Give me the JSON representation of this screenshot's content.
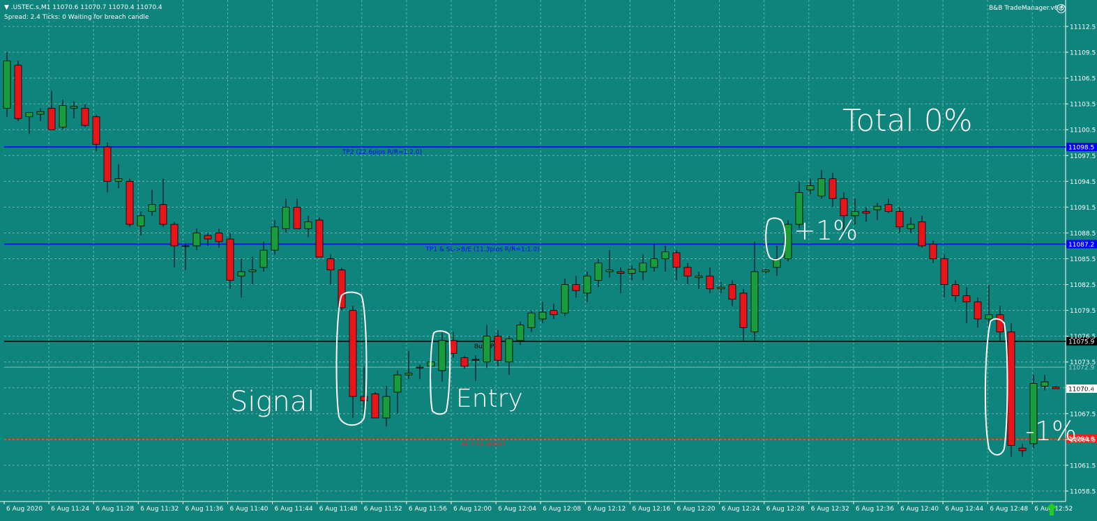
{
  "header": {
    "symbol_line": ".USTEC.s,M1  11070.6 11070.7 11070.4 11070.4",
    "status_line": "Spread: 2.4   Ticks: 0   Waiting for breach candle",
    "brand": "B&B TradeManager.v6.6",
    "colors": {
      "background": "#0e847c",
      "bull": "#1a9c3a",
      "bear": "#e8141c",
      "tp_line": "#0000ff",
      "sl_line": "#ff1a1a",
      "entry_line": "#000000",
      "grid": "#69b3ad"
    }
  },
  "annotations": {
    "total": "Total 0%",
    "plus": "+1%",
    "minus": "-1%",
    "signal": "Signal",
    "entry": "Entry"
  },
  "chart_data": {
    "type": "candlestick",
    "title": "",
    "xlabel": "",
    "ylabel": "",
    "ylim": [
      11057.5,
      11114.0
    ],
    "y_ticks": [
      "11112.5",
      "11109.5",
      "11106.5",
      "11103.5",
      "11100.5",
      "11097.5",
      "11094.5",
      "11091.5",
      "11088.5",
      "11085.5",
      "11082.5",
      "11079.5",
      "11076.5",
      "11073.5",
      "11070.5",
      "11067.5",
      "11064.5",
      "11061.5",
      "11058.5"
    ],
    "x_ticks": [
      "6 Aug 2020",
      "6 Aug 11:24",
      "6 Aug 11:28",
      "6 Aug 11:32",
      "6 Aug 11:36",
      "6 Aug 11:40",
      "6 Aug 11:44",
      "6 Aug 11:48",
      "6 Aug 11:52",
      "6 Aug 11:56",
      "6 Aug 12:00",
      "6 Aug 12:04",
      "6 Aug 12:08",
      "6 Aug 12:12",
      "6 Aug 12:16",
      "6 Aug 12:20",
      "6 Aug 12:24",
      "6 Aug 12:28",
      "6 Aug 12:32",
      "6 Aug 12:36",
      "6 Aug 12:40",
      "6 Aug 12:44",
      "6 Aug 12:48",
      "6 Aug 12:52"
    ],
    "candles": [
      {
        "o": 11103.0,
        "h": 11109.5,
        "l": 11102.0,
        "c": 11108.5
      },
      {
        "o": 11108.0,
        "h": 11108.5,
        "l": 11101.5,
        "c": 11101.8
      },
      {
        "o": 11102.0,
        "h": 11102.5,
        "l": 11100.0,
        "c": 11102.5
      },
      {
        "o": 11102.3,
        "h": 11103.0,
        "l": 11101.5,
        "c": 11102.6
      },
      {
        "o": 11103.0,
        "h": 11105.0,
        "l": 11100.5,
        "c": 11100.5
      },
      {
        "o": 11100.8,
        "h": 11104.0,
        "l": 11100.5,
        "c": 11103.3
      },
      {
        "o": 11103.0,
        "h": 11103.8,
        "l": 11101.8,
        "c": 11103.2
      },
      {
        "o": 11103.0,
        "h": 11103.5,
        "l": 11100.8,
        "c": 11101.0
      },
      {
        "o": 11102.0,
        "h": 11102.2,
        "l": 11098.0,
        "c": 11098.8
      },
      {
        "o": 11098.5,
        "h": 11099.0,
        "l": 11093.2,
        "c": 11094.5
      },
      {
        "o": 11094.5,
        "h": 11096.5,
        "l": 11093.7,
        "c": 11094.8
      },
      {
        "o": 11094.5,
        "h": 11094.8,
        "l": 11089.2,
        "c": 11089.5
      },
      {
        "o": 11089.3,
        "h": 11091.0,
        "l": 11088.2,
        "c": 11090.5
      },
      {
        "o": 11091.0,
        "h": 11093.5,
        "l": 11090.5,
        "c": 11091.8
      },
      {
        "o": 11091.8,
        "h": 11094.8,
        "l": 11089.2,
        "c": 11089.5
      },
      {
        "o": 11089.5,
        "h": 11089.8,
        "l": 11084.5,
        "c": 11087.0
      },
      {
        "o": 11087.0,
        "h": 11087.2,
        "l": 11084.2,
        "c": 11087.0
      },
      {
        "o": 11087.0,
        "h": 11089.0,
        "l": 11086.5,
        "c": 11088.5
      },
      {
        "o": 11088.2,
        "h": 11088.5,
        "l": 11087.0,
        "c": 11087.8
      },
      {
        "o": 11088.5,
        "h": 11089.0,
        "l": 11086.8,
        "c": 11087.5
      },
      {
        "o": 11087.8,
        "h": 11088.5,
        "l": 11082.0,
        "c": 11083.0
      },
      {
        "o": 11083.5,
        "h": 11085.5,
        "l": 11081.0,
        "c": 11084.0
      },
      {
        "o": 11084.0,
        "h": 11085.7,
        "l": 11082.5,
        "c": 11084.2
      },
      {
        "o": 11084.5,
        "h": 11087.5,
        "l": 11084.0,
        "c": 11086.5
      },
      {
        "o": 11086.5,
        "h": 11090.0,
        "l": 11086.0,
        "c": 11089.2
      },
      {
        "o": 11089.0,
        "h": 11092.5,
        "l": 11088.5,
        "c": 11091.5
      },
      {
        "o": 11091.5,
        "h": 11092.5,
        "l": 11089.0,
        "c": 11089.0
      },
      {
        "o": 11089.0,
        "h": 11090.5,
        "l": 11088.0,
        "c": 11089.8
      },
      {
        "o": 11090.0,
        "h": 11090.3,
        "l": 11085.7,
        "c": 11085.7
      },
      {
        "o": 11085.5,
        "h": 11086.0,
        "l": 11082.5,
        "c": 11084.2
      },
      {
        "o": 11084.2,
        "h": 11084.5,
        "l": 11079.5,
        "c": 11079.8
      },
      {
        "o": 11079.5,
        "h": 11080.0,
        "l": 11067.0,
        "c": 11069.5
      },
      {
        "o": 11069.5,
        "h": 11073.0,
        "l": 11067.5,
        "c": 11069.0
      },
      {
        "o": 11069.8,
        "h": 11070.0,
        "l": 11067.0,
        "c": 11067.0
      },
      {
        "o": 11067.0,
        "h": 11070.7,
        "l": 11066.0,
        "c": 11069.5
      },
      {
        "o": 11070.0,
        "h": 11072.5,
        "l": 11067.5,
        "c": 11072.0
      },
      {
        "o": 11072.0,
        "h": 11074.8,
        "l": 11071.5,
        "c": 11072.2
      },
      {
        "o": 11072.8,
        "h": 11073.2,
        "l": 11071.5,
        "c": 11072.9
      },
      {
        "o": 11073.0,
        "h": 11074.2,
        "l": 11071.3,
        "c": 11073.5
      },
      {
        "o": 11072.5,
        "h": 11077.0,
        "l": 11071.2,
        "c": 11076.0
      },
      {
        "o": 11076.0,
        "h": 11077.0,
        "l": 11074.0,
        "c": 11074.5
      },
      {
        "o": 11074.0,
        "h": 11074.2,
        "l": 11072.7,
        "c": 11073.0
      },
      {
        "o": 11073.8,
        "h": 11074.3,
        "l": 11071.3,
        "c": 11073.7
      },
      {
        "o": 11073.5,
        "h": 11077.8,
        "l": 11072.8,
        "c": 11076.5
      },
      {
        "o": 11076.5,
        "h": 11077.2,
        "l": 11073.0,
        "c": 11073.7
      },
      {
        "o": 11073.5,
        "h": 11076.5,
        "l": 11072.0,
        "c": 11076.2
      },
      {
        "o": 11076.0,
        "h": 11078.2,
        "l": 11075.5,
        "c": 11077.8
      },
      {
        "o": 11077.5,
        "h": 11079.5,
        "l": 11077.0,
        "c": 11079.2
      },
      {
        "o": 11078.5,
        "h": 11080.5,
        "l": 11078.0,
        "c": 11079.3
      },
      {
        "o": 11079.5,
        "h": 11080.3,
        "l": 11078.5,
        "c": 11079.0
      },
      {
        "o": 11079.2,
        "h": 11083.2,
        "l": 11078.8,
        "c": 11082.5
      },
      {
        "o": 11082.5,
        "h": 11083.5,
        "l": 11081.0,
        "c": 11081.8
      },
      {
        "o": 11081.5,
        "h": 11084.0,
        "l": 11080.5,
        "c": 11083.5
      },
      {
        "o": 11083.0,
        "h": 11085.5,
        "l": 11082.2,
        "c": 11085.0
      },
      {
        "o": 11084.0,
        "h": 11086.5,
        "l": 11083.3,
        "c": 11084.2
      },
      {
        "o": 11084.0,
        "h": 11084.5,
        "l": 11081.5,
        "c": 11083.8
      },
      {
        "o": 11083.8,
        "h": 11084.7,
        "l": 11083.0,
        "c": 11084.3
      },
      {
        "o": 11084.0,
        "h": 11086.0,
        "l": 11083.0,
        "c": 11085.0
      },
      {
        "o": 11084.5,
        "h": 11087.2,
        "l": 11084.0,
        "c": 11085.5
      },
      {
        "o": 11085.5,
        "h": 11087.0,
        "l": 11084.0,
        "c": 11086.3
      },
      {
        "o": 11086.2,
        "h": 11086.5,
        "l": 11083.0,
        "c": 11084.5
      },
      {
        "o": 11084.5,
        "h": 11085.0,
        "l": 11082.5,
        "c": 11083.5
      },
      {
        "o": 11083.3,
        "h": 11084.0,
        "l": 11082.0,
        "c": 11083.5
      },
      {
        "o": 11083.5,
        "h": 11084.5,
        "l": 11081.5,
        "c": 11082.0
      },
      {
        "o": 11082.0,
        "h": 11082.8,
        "l": 11081.5,
        "c": 11082.2
      },
      {
        "o": 11082.5,
        "h": 11083.0,
        "l": 11080.0,
        "c": 11080.8
      },
      {
        "o": 11081.5,
        "h": 11082.0,
        "l": 11076.0,
        "c": 11077.5
      },
      {
        "o": 11077.0,
        "h": 11087.5,
        "l": 11076.0,
        "c": 11084.0
      },
      {
        "o": 11084.0,
        "h": 11084.3,
        "l": 11083.8,
        "c": 11084.2
      },
      {
        "o": 11084.5,
        "h": 11087.0,
        "l": 11083.5,
        "c": 11085.5
      },
      {
        "o": 11085.5,
        "h": 11090.0,
        "l": 11085.2,
        "c": 11089.5
      },
      {
        "o": 11089.5,
        "h": 11094.5,
        "l": 11089.0,
        "c": 11093.2
      },
      {
        "o": 11093.5,
        "h": 11094.8,
        "l": 11093.0,
        "c": 11094.0
      },
      {
        "o": 11092.8,
        "h": 11095.8,
        "l": 11092.5,
        "c": 11094.8
      },
      {
        "o": 11094.8,
        "h": 11095.5,
        "l": 11091.5,
        "c": 11092.5
      },
      {
        "o": 11092.5,
        "h": 11093.2,
        "l": 11088.5,
        "c": 11090.5
      },
      {
        "o": 11090.5,
        "h": 11092.5,
        "l": 11089.5,
        "c": 11091.0
      },
      {
        "o": 11091.0,
        "h": 11091.5,
        "l": 11089.8,
        "c": 11090.8
      },
      {
        "o": 11091.2,
        "h": 11092.0,
        "l": 11090.0,
        "c": 11091.6
      },
      {
        "o": 11091.8,
        "h": 11092.5,
        "l": 11090.8,
        "c": 11091.0
      },
      {
        "o": 11091.0,
        "h": 11091.5,
        "l": 11088.5,
        "c": 11089.2
      },
      {
        "o": 11089.0,
        "h": 11090.3,
        "l": 11088.5,
        "c": 11089.5
      },
      {
        "o": 11089.8,
        "h": 11090.5,
        "l": 11086.8,
        "c": 11087.0
      },
      {
        "o": 11087.2,
        "h": 11087.6,
        "l": 11085.0,
        "c": 11085.5
      },
      {
        "o": 11085.5,
        "h": 11086.0,
        "l": 11081.0,
        "c": 11082.5
      },
      {
        "o": 11082.5,
        "h": 11083.0,
        "l": 11080.5,
        "c": 11081.2
      },
      {
        "o": 11081.2,
        "h": 11082.2,
        "l": 11078.0,
        "c": 11080.5
      },
      {
        "o": 11080.5,
        "h": 11081.0,
        "l": 11077.5,
        "c": 11078.5
      },
      {
        "o": 11078.5,
        "h": 11082.5,
        "l": 11077.0,
        "c": 11079.0
      },
      {
        "o": 11079.0,
        "h": 11080.0,
        "l": 11076.0,
        "c": 11077.0
      },
      {
        "o": 11077.0,
        "h": 11078.0,
        "l": 11062.5,
        "c": 11063.8
      },
      {
        "o": 11063.5,
        "h": 11064.0,
        "l": 11062.5,
        "c": 11063.2
      },
      {
        "o": 11064.0,
        "h": 11072.0,
        "l": 11063.5,
        "c": 11071.0
      },
      {
        "o": 11070.7,
        "h": 11072.0,
        "l": 11070.2,
        "c": 11071.2
      },
      {
        "o": 11070.6,
        "h": 11070.7,
        "l": 11070.4,
        "c": 11070.4
      }
    ],
    "levels": [
      {
        "name": "TP2",
        "label": "TP2 (22.6pips R/R=1:2.0)",
        "value": 11098.5,
        "price_label": "11098.5",
        "color": "#0000ff"
      },
      {
        "name": "TP1",
        "label": "TP1 & SL->B/E (11.3pips R/R=1:1.0)",
        "value": 11087.2,
        "price_label": "11087.2",
        "color": "#0000ff"
      },
      {
        "name": "BuyEP",
        "label": "BuyEP",
        "value": 11075.9,
        "price_label": "11075.9",
        "color": "#000000"
      },
      {
        "name": "Bid",
        "label": "",
        "value": 11072.9,
        "price_label": "11072.9",
        "color": "#7fbfba"
      },
      {
        "name": "Current",
        "label": "",
        "value": 11070.4,
        "price_label": "11070.4",
        "color": "#ffffff"
      },
      {
        "name": "SL",
        "label": "SL (-11.3pips)",
        "value": 11064.6,
        "price_label": "11064.6",
        "color": "#ff1a1a"
      }
    ]
  }
}
